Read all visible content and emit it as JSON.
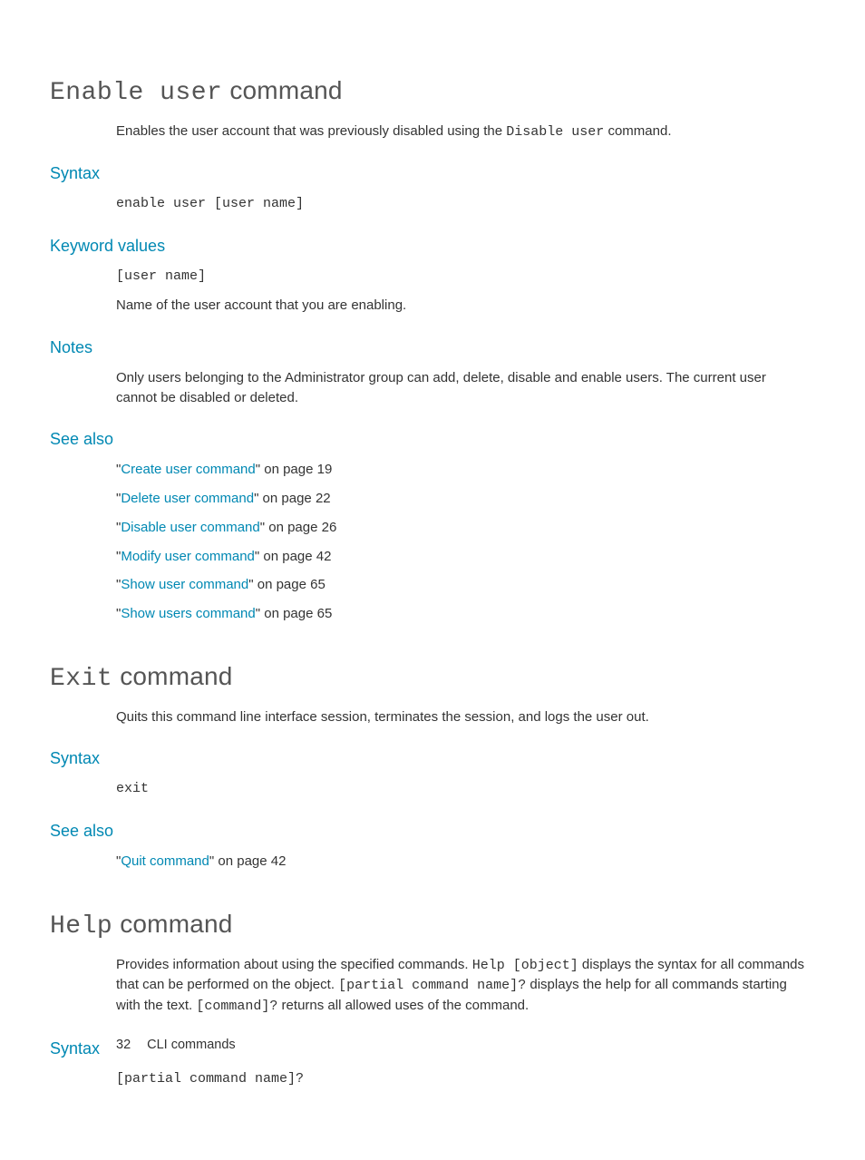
{
  "sections": [
    {
      "heading_mono": "Enable user",
      "heading_plain": " command",
      "description_pre": "Enables the user account that was previously disabled using the ",
      "description_mono": "Disable user",
      "description_post": " command.",
      "syntax_label": "Syntax",
      "syntax_code": "enable user [user name]",
      "keyword_label": "Keyword values",
      "keyword_code": "[user name]",
      "keyword_desc": "Name of the user account that you are enabling.",
      "notes_label": "Notes",
      "notes_text": "Only users belonging to the Administrator group can add, delete, disable and enable users. The current user cannot be disabled or deleted.",
      "seealso_label": "See also",
      "seealso": [
        {
          "link": "Create user command",
          "suffix": " on page 19"
        },
        {
          "link": "Delete user command",
          "suffix": " on page 22"
        },
        {
          "link": "Disable user command",
          "suffix": " on page 26"
        },
        {
          "link": "Modify user command",
          "suffix": " on page 42"
        },
        {
          "link": "Show user command",
          "suffix": " on page 65"
        },
        {
          "link": "Show users command",
          "suffix": " on page 65"
        }
      ]
    },
    {
      "heading_mono": "Exit",
      "heading_plain": " command",
      "description": "Quits this command line interface session, terminates the session, and logs the user out.",
      "syntax_label": "Syntax",
      "syntax_code": "exit",
      "seealso_label": "See also",
      "seealso": [
        {
          "link": "Quit command",
          "suffix": " on page 42"
        }
      ]
    },
    {
      "heading_mono": "Help",
      "heading_plain": " command",
      "desc_parts": [
        {
          "text": "Provides information about using the specified commands. "
        },
        {
          "mono": "Help [object]"
        },
        {
          "text": " displays the syntax for all commands that can be performed on the object. "
        },
        {
          "mono": "[partial command name]?"
        },
        {
          "text": " displays the help for all commands starting with the text. "
        },
        {
          "mono": "[command]?"
        },
        {
          "text": " returns all allowed uses of the command."
        }
      ],
      "syntax_label": "Syntax",
      "syntax_code": "[partial command name]?"
    }
  ],
  "footer": {
    "page_number": "32",
    "chapter": "CLI commands"
  }
}
